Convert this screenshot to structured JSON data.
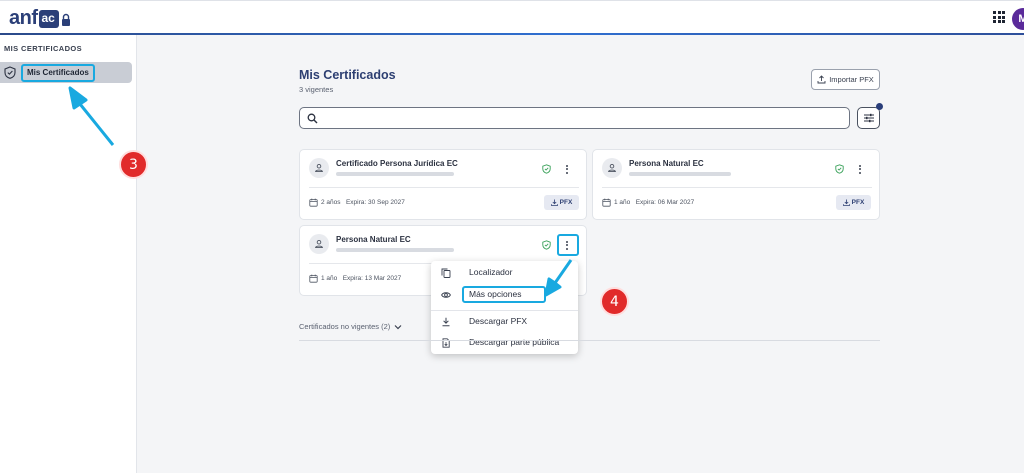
{
  "app": {
    "logo_text": "anf",
    "logo_mark": "ac",
    "avatar_initial": "M"
  },
  "sidebar": {
    "heading": "MIS CERTIFICADOS",
    "items": [
      {
        "label": "Mis Certificados",
        "icon": "shield-check-icon",
        "active": true
      }
    ]
  },
  "main": {
    "title": "Mis Certificados",
    "subtitle": "3 vigentes",
    "import_label": "Importar PFX",
    "search": {
      "placeholder": "",
      "value": ""
    },
    "cards": [
      {
        "title": "Certificado Persona Jurídica EC",
        "duration": "2 años",
        "expires": "Expira: 30 Sep 2027",
        "download_label": "PFX"
      },
      {
        "title": "Persona Natural EC",
        "duration": "1 año",
        "expires": "Expira: 06 Mar 2027",
        "download_label": "PFX"
      },
      {
        "title": "Persona Natural EC",
        "duration": "1 año",
        "expires": "Expira: 13 Mar 2027"
      }
    ],
    "nonvalid_label": "Certificados no vigentes (2)"
  },
  "context_menu": {
    "items": [
      {
        "label": "Localizador",
        "icon": "copy-icon"
      },
      {
        "label": "Más opciones",
        "icon": "eye-icon"
      },
      {
        "label": "Descargar PFX",
        "icon": "download-icon"
      },
      {
        "label": "Descargar parte pública",
        "icon": "file-download-icon"
      }
    ]
  },
  "annotations": {
    "step_sidebar": "3",
    "step_menu": "4"
  },
  "colors": {
    "brand": "#2d3f72",
    "highlight": "#19a9e0",
    "badge": "#e12a2a",
    "verified": "#3aa15a"
  }
}
